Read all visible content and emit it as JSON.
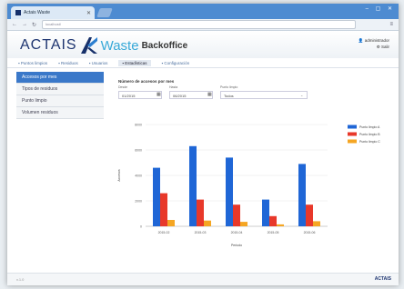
{
  "browser": {
    "tab_title": "Actais Waste",
    "url": "localhost/"
  },
  "header": {
    "brand_left": "ACTAIS",
    "brand_product": "Waste",
    "brand_suffix": "Backoffice",
    "user_name": "administrador",
    "logout": "Salir"
  },
  "topnav": [
    {
      "label": "Puntos limpios"
    },
    {
      "label": "Residuos"
    },
    {
      "label": "Usuarios"
    },
    {
      "label": "Estadísticas"
    },
    {
      "label": "Configuración"
    }
  ],
  "sidebar": [
    {
      "label": "Accesos por mes"
    },
    {
      "label": "Tipos de residuos"
    },
    {
      "label": "Punto limpio"
    },
    {
      "label": "Volumen residuos"
    }
  ],
  "panel": {
    "title": "Número de accesos por mes",
    "from_label": "Desde",
    "from_value": "01/2015",
    "to_label": "Hasta",
    "to_value": "06/2015",
    "point_label": "Punto limpio",
    "point_value": "Todos"
  },
  "chart_data": {
    "type": "bar",
    "categories": [
      "2015-02",
      "2015-03",
      "2015-04",
      "2015-05",
      "2015-06"
    ],
    "series": [
      {
        "name": "Punto limpio A",
        "color": "#1f66d6",
        "values": [
          4600,
          6300,
          5400,
          2100,
          4900
        ]
      },
      {
        "name": "Punto limpio B",
        "color": "#e8382a",
        "values": [
          2600,
          2100,
          1700,
          800,
          1700
        ]
      },
      {
        "name": "Punto limpio C",
        "color": "#f5a623",
        "values": [
          500,
          450,
          350,
          150,
          400
        ]
      }
    ],
    "yticks": [
      "0",
      "2000",
      "4000",
      "6000",
      "8000"
    ],
    "ylim": [
      0,
      8000
    ],
    "ylabel": "Accesos",
    "xlabel": "Periodo",
    "legend_position": "right"
  },
  "footer": {
    "left": "v.1.0",
    "logo": "ACTAIS"
  }
}
